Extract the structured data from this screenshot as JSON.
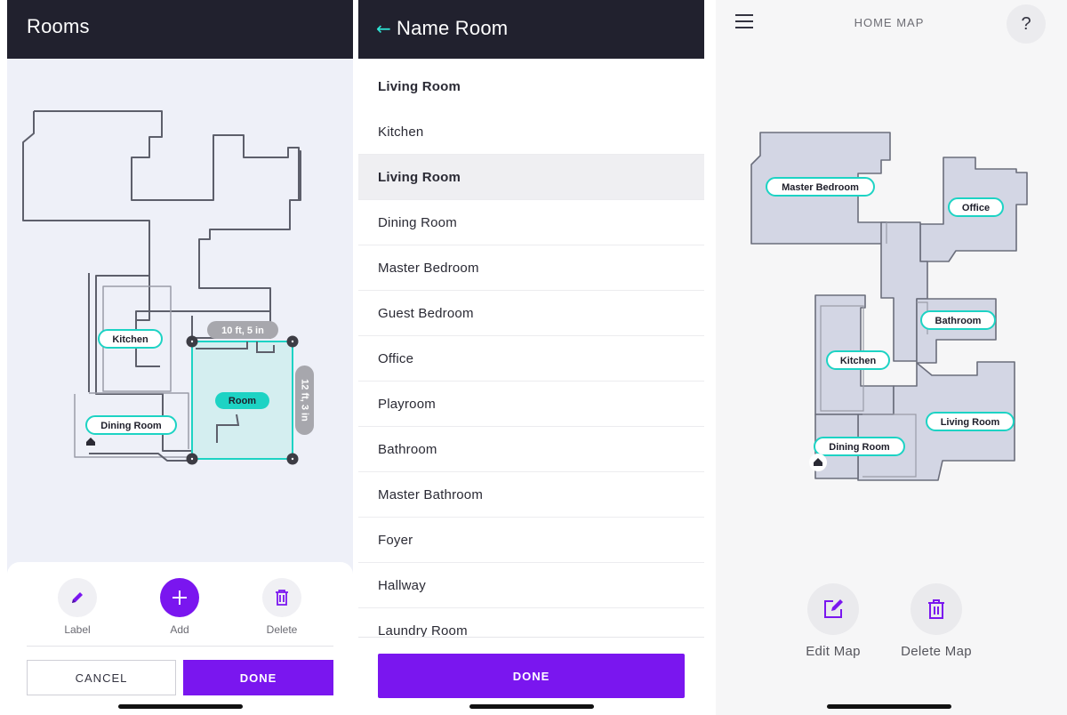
{
  "rooms_screen": {
    "title": "Rooms",
    "map_labels": {
      "kitchen": "Kitchen",
      "dining": "Dining Room",
      "room": "Room"
    },
    "dimension_width": "10 ft, 5 in",
    "dimension_height": "12 ft, 3 in",
    "tools": {
      "label": "Label",
      "add": "Add",
      "delete": "Delete"
    },
    "cancel_label": "CANCEL",
    "done_label": "DONE"
  },
  "name_room_screen": {
    "title": "Name Room",
    "back_icon": "arrow-left-icon",
    "current_name": "Living Room",
    "options": [
      "Kitchen",
      "Living Room",
      "Dining Room",
      "Master Bedroom",
      "Guest Bedroom",
      "Office",
      "Playroom",
      "Bathroom",
      "Master Bathroom",
      "Foyer",
      "Hallway",
      "Laundry Room"
    ],
    "selected_option": "Living Room",
    "done_label": "DONE"
  },
  "home_map_screen": {
    "title": "HOME MAP",
    "help_label": "?",
    "labels": {
      "master_bedroom": "Master Bedroom",
      "office": "Office",
      "bathroom": "Bathroom",
      "kitchen": "Kitchen",
      "living_room": "Living Room",
      "dining_room": "Dining Room"
    },
    "edit_label": "Edit Map",
    "delete_label": "Delete Map"
  },
  "colors": {
    "accent_purple": "#7a16ef",
    "accent_teal": "#2ee6d6",
    "header_dark": "#21212e",
    "map_fill": "#d3d6e4"
  }
}
